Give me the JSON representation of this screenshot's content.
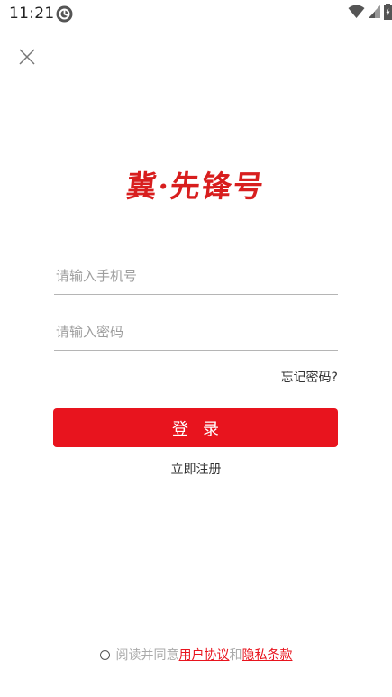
{
  "status_bar": {
    "time": "11:21",
    "icons": [
      "app-notification-icon",
      "wifi-icon",
      "signal-icon",
      "battery-icon"
    ]
  },
  "header": {
    "close_icon": "close-icon"
  },
  "logo": {
    "text": "冀·先锋号",
    "color": "#d81e1e"
  },
  "form": {
    "phone_placeholder": "请输入手机号",
    "phone_value": "",
    "password_placeholder": "请输入密码",
    "password_value": "",
    "forgot_password": "忘记密码?",
    "login_button": "登录",
    "register_link": "立即注册"
  },
  "agreement": {
    "checked": false,
    "prefix": "阅读并同意",
    "user_agreement": "用户协议",
    "conjunction": "和",
    "privacy_policy": "隐私条款"
  },
  "colors": {
    "accent": "#e8141e",
    "placeholder": "#9e9e9e",
    "agreement_text": "#aaaaaa"
  }
}
